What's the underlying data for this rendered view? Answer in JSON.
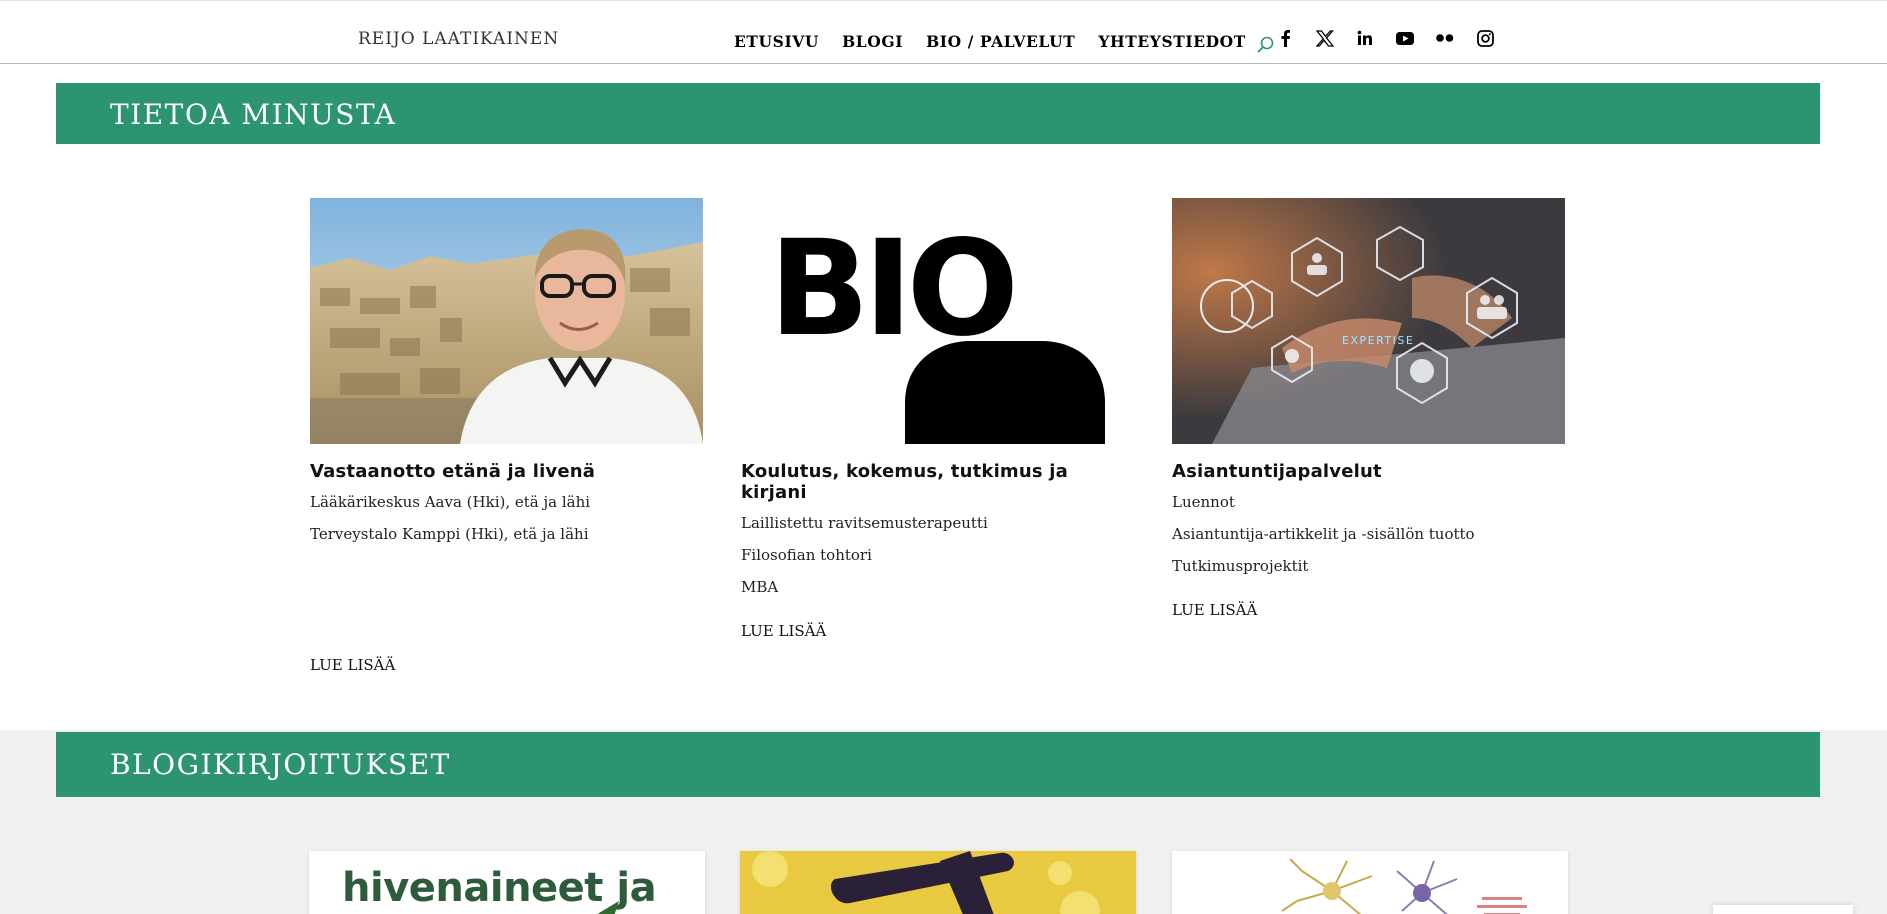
{
  "header": {
    "site_title": "REIJO LAATIKAINEN",
    "nav": [
      "ETUSIVU",
      "BLOGI",
      "BIO / PALVELUT",
      "YHTEYSTIEDOT"
    ],
    "social_icons": [
      "facebook-icon",
      "x-icon",
      "linkedin-icon",
      "youtube-icon",
      "flickr-icon",
      "instagram-icon"
    ],
    "accent_color": "#2d9470"
  },
  "about": {
    "title": "TIETOA MINUSTA",
    "cards": [
      {
        "image": "portrait-photo",
        "heading": "Vastaanotto etänä ja livenä",
        "lines": [
          "Lääkärikeskus Aava (Hki), etä ja lähi",
          "Terveystalo Kamppi (Hki), etä ja lähi"
        ],
        "more": "LUE LISÄÄ"
      },
      {
        "image": "bio-graphic",
        "image_text": "BIO",
        "heading": "Koulutus, kokemus, tutkimus ja kirjani",
        "lines": [
          "Laillistettu ravitsemusterapeutti",
          "Filosofian tohtori",
          "MBA"
        ],
        "more": "LUE LISÄÄ"
      },
      {
        "image": "expertise-graphic",
        "image_text": "EXPERTISE",
        "heading": "Asiantuntijapalvelut",
        "lines": [
          "Luennot",
          "Asiantuntija-artikkelit ja -sisällön tuotto",
          "Tutkimusprojektit"
        ],
        "more": "LUE LISÄÄ"
      }
    ]
  },
  "blog": {
    "title": "BLOGIKIRJOITUKSET",
    "cards": [
      {
        "image": "hivenaineet-graphic",
        "image_text": "hivenaineet ja"
      },
      {
        "image": "yellow-abstract-graphic"
      },
      {
        "image": "neuron-graphic"
      }
    ]
  }
}
